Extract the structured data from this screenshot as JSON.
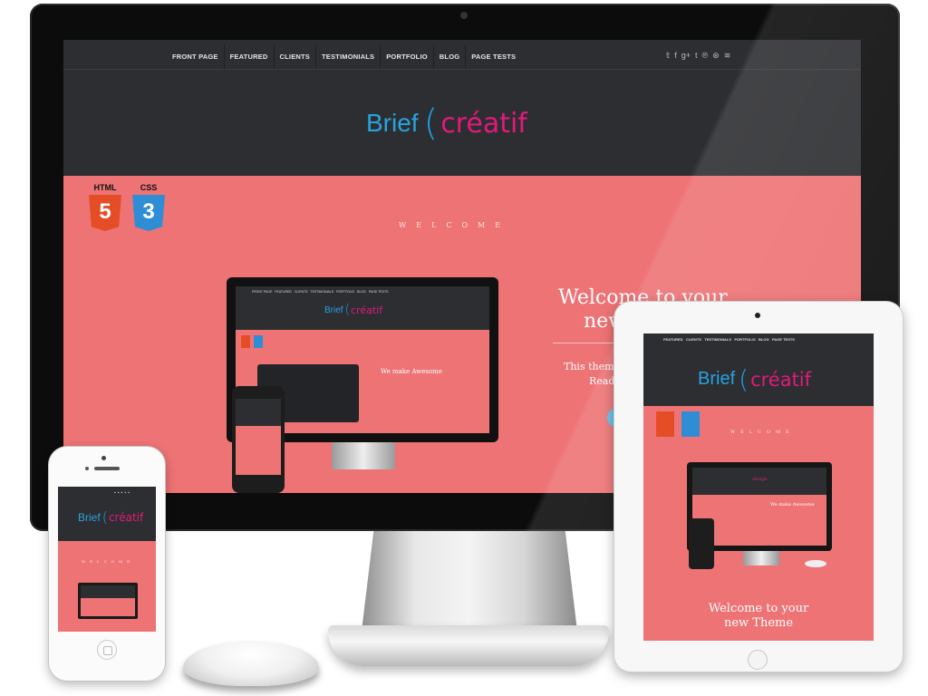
{
  "nav": {
    "items": [
      "FRONT PAGE",
      "FEATURED",
      "CLIENTS",
      "TESTIMONIALS",
      "PORTFOLIO",
      "BLOG",
      "PAGE TESTS"
    ],
    "social_icons": [
      "twitter-icon",
      "facebook-icon",
      "google-plus-icon",
      "tumblr-icon",
      "pinterest-icon",
      "dribbble-icon",
      "rss-icon"
    ],
    "social_glyphs": [
      "𝕥",
      "f",
      "g+",
      "t",
      "℗",
      "⊛",
      "≋"
    ]
  },
  "logo": {
    "part1": "Brief",
    "paren": "(",
    "part2": "créatif"
  },
  "badges": {
    "html_label": "HTML",
    "html_digit": "5",
    "css_label": "CSS",
    "css_digit": "3"
  },
  "welcome": "WELCOME",
  "hero": {
    "heading_line1": "Welcome to your",
    "heading_line2": "new",
    "text_line1": "This theme i",
    "text_line2": "Read c"
  },
  "mini": {
    "awesome": "We make Awesome",
    "design": "design"
  },
  "ipad_hero": {
    "line1": "Welcome to your",
    "line2": "new Theme"
  },
  "colors": {
    "header": "#2d2e31",
    "body": "#ee7375",
    "logo_blue": "#27a3e0",
    "logo_pink": "#e2197b"
  }
}
